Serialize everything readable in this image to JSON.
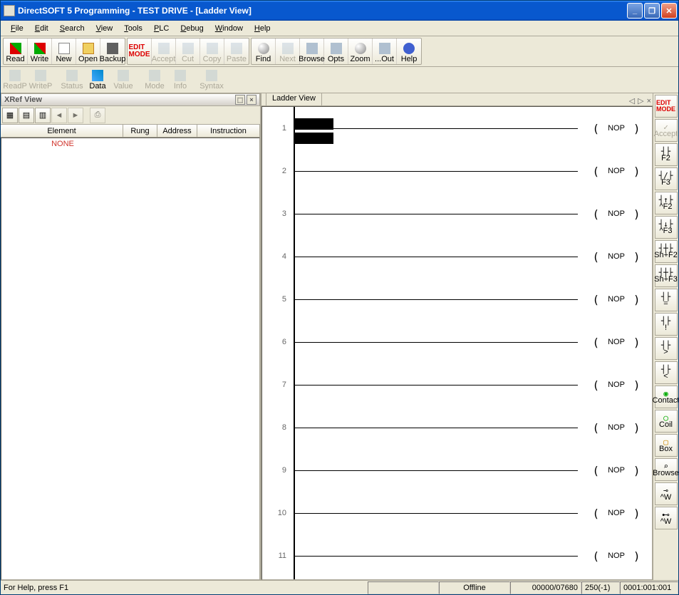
{
  "title": "DirectSOFT 5 Programming - TEST DRIVE - [Ladder View]",
  "menu": {
    "file": "File",
    "edit": "Edit",
    "search": "Search",
    "view": "View",
    "tools": "Tools",
    "plc": "PLC",
    "debug": "Debug",
    "window": "Window",
    "help": "Help"
  },
  "tb1": {
    "read": "Read",
    "write": "Write",
    "new": "New",
    "open": "Open",
    "backup": "Backup",
    "editmode": "EDIT MODE",
    "accept": "Accept",
    "cut": "Cut",
    "copy": "Copy",
    "paste": "Paste",
    "find": "Find",
    "next": "Next",
    "browse": "Browse",
    "opts": "Opts",
    "zoom": "Zoom",
    "out": "...Out",
    "help": "Help"
  },
  "tb2": {
    "readp": "ReadP",
    "writep": "WriteP",
    "status": "Status",
    "data": "Data",
    "value": "Value",
    "mode": "Mode",
    "info": "Info",
    "syntax": "Syntax"
  },
  "xref": {
    "title": "XRef View",
    "cols": {
      "element": "Element",
      "rung": "Rung",
      "address": "Address",
      "instruction": "Instruction"
    },
    "none": "NONE"
  },
  "ladder": {
    "tab": "Ladder View",
    "rows": [
      1,
      2,
      3,
      4,
      5,
      6,
      7,
      8,
      9,
      10,
      11
    ],
    "nop": "NOP"
  },
  "rr": {
    "editmode": "EDIT MODE",
    "accept": "Accept",
    "f2": "F2",
    "f3": "F3",
    "cf2": "^F2",
    "cf3": "^F3",
    "shf2": "Sh+F2",
    "shf3": "Sh+F3",
    "eq": "=",
    "ex": "!",
    "gt": ">",
    "lt": "<",
    "contact": "Contact",
    "coil": "Coil",
    "box": "Box",
    "browse": "Browse",
    "aw": "^W",
    "wdn": "^W"
  },
  "status": {
    "help": "For Help, press F1",
    "mode": "Offline",
    "counter": "00000/07680",
    "pos": "250(-1)",
    "addr": "0001:001:001"
  }
}
